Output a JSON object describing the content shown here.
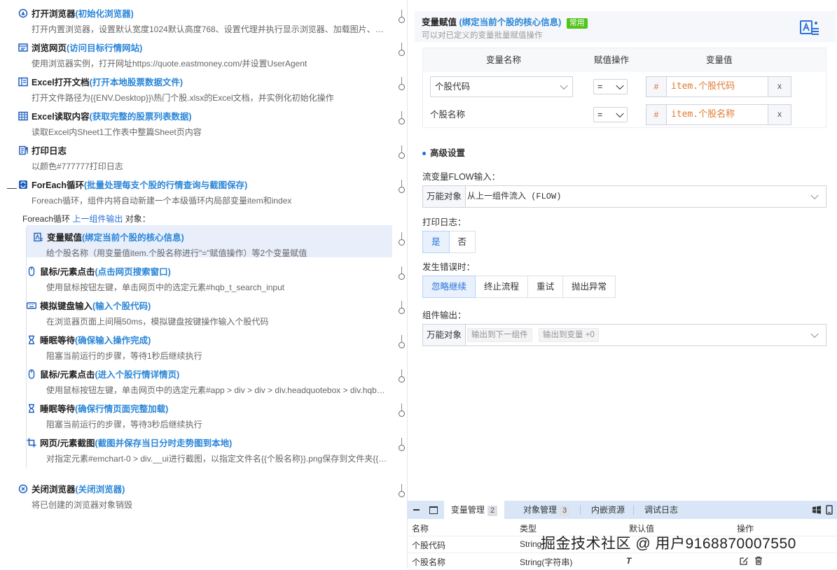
{
  "flow": {
    "steps": [
      {
        "title": "打开浏览器",
        "note": "(初始化浏览器)",
        "desc": "打开内置浏览器，设置默认宽度1024默认高度768、设置代理并执行显示浏览器、加载图片、…",
        "icon": "browser-open-icon"
      },
      {
        "title": "浏览网页",
        "note": "(访问目标行情网站)",
        "desc": "使用浏览器实例，打开网址https://quote.eastmoney.com/并设置UserAgent",
        "icon": "webpage-icon"
      },
      {
        "title": "Excel打开文档",
        "note": "(打开本地股票数据文件)",
        "desc": "打开文件路径为{{ENV.Desktop}}\\热门个股.xlsx的Excel文档，并实例化初始化操作",
        "icon": "excel-open-icon"
      },
      {
        "title": "Excel读取内容",
        "note": "(获取完整的股票列表数据)",
        "desc": "读取Excel内Sheet1工作表中整篇Sheet页内容",
        "icon": "excel-read-icon"
      },
      {
        "title": "打印日志",
        "note": "",
        "desc": "以颜色#777777打印日志",
        "icon": "print-log-icon"
      },
      {
        "title": "ForEach循环",
        "note": " (批量处理每支个股的行情查询与截图保存)",
        "desc": "Foreach循环，组件内将自动新建一个本级循环内局部变量item和index",
        "icon": "foreach-icon"
      }
    ],
    "foreach_prefix": "Foreach循环",
    "foreach_link": "上一组件输出",
    "foreach_suffix": " 对象：",
    "inner_steps": [
      {
        "title": "变量赋值",
        "note": "(绑定当前个股的核心信息)",
        "desc": "给个股名称（用变量值item.个股名称进行\"=\"赋值操作）等2个变量赋值",
        "icon": "variable-assign-icon"
      },
      {
        "title": "鼠标/元素点击",
        "note": "(点击网页搜索窗口)",
        "desc": "使用鼠标按钮左键，单击网页中的选定元素#hqb_t_search_input",
        "icon": "mouse-click-icon"
      },
      {
        "title": "模拟键盘输入",
        "note": "(输入个股代码)",
        "desc": "在浏览器页面上间隔50ms，模拟键盘按键操作输入个股代码",
        "icon": "keyboard-icon"
      },
      {
        "title": "睡眠等待",
        "note": "(确保输入操作完成)",
        "desc": "阻塞当前运行的步骤，等待1秒后继续执行",
        "icon": "hourglass-icon"
      },
      {
        "title": "鼠标/元素点击",
        "note": "(进入个股行情详情页)",
        "desc": "使用鼠标按钮左键，单击网页中的选定元素#app > div > div > div.headquotebox > div.hqb…",
        "icon": "mouse-click-icon"
      },
      {
        "title": "睡眠等待",
        "note": "(确保行情页面完整加载)",
        "desc": "阻塞当前运行的步骤，等待3秒后继续执行",
        "icon": "hourglass-icon"
      },
      {
        "title": "网页/元素截图",
        "note": "(截图并保存当日分时走势图到本地)",
        "desc": "对指定元素#emchart-0 > div.__ui进行截图，以指定文件名{{个股名称}}.png保存到文件夹{{…",
        "icon": "crop-icon"
      }
    ],
    "final_step": {
      "title": "关闭浏览器",
      "note": "(关闭浏览器)",
      "desc": "将已创建的浏览器对象销毁",
      "icon": "browser-close-icon"
    }
  },
  "panel": {
    "title": "变量赋值",
    "note": " (绑定当前个股的核心信息)",
    "badge": "常用",
    "subtitle": "可以对已定义的变量批量赋值操作",
    "table": {
      "headers": [
        "变量名称",
        "赋值操作",
        "变量值"
      ],
      "rows": [
        {
          "name": "个股代码",
          "op": "=",
          "value": "item.个股代码",
          "remove": "x"
        },
        {
          "name": "个股名称",
          "op": "=",
          "value": "item.个股名称",
          "remove": "x"
        }
      ],
      "hash": "#"
    },
    "advanced_label": "高级设置",
    "flow_input_label": "流变量FLOW输入：",
    "flow_input_prefix": "万能对象",
    "flow_input_value": "从上一组件流入 (FLOW)",
    "print_log_label": "打印日志：",
    "print_log_options": [
      "是",
      "否"
    ],
    "on_error_label": "发生错误时：",
    "on_error_options": [
      "忽略继续",
      "终止流程",
      "重试",
      "抛出异常"
    ],
    "output_label": "组件输出：",
    "output_prefix": "万能对象",
    "output_tags": [
      "输出到下一组件",
      "输出到变量 +0"
    ]
  },
  "bottom": {
    "tabs": [
      {
        "label": "变量管理",
        "count": "2"
      },
      {
        "label": "对象管理",
        "count": "3"
      },
      {
        "label": "内嵌资源",
        "count": ""
      },
      {
        "label": "调试日志",
        "count": ""
      }
    ],
    "columns": [
      "名称",
      "类型",
      "默认值",
      "操作"
    ],
    "rows": [
      {
        "name": "个股代码",
        "type": "String"
      },
      {
        "name": "个股名称",
        "type": "String(字符串)"
      }
    ],
    "watermark": "掘金技术社区 @ 用户9168870007550"
  }
}
